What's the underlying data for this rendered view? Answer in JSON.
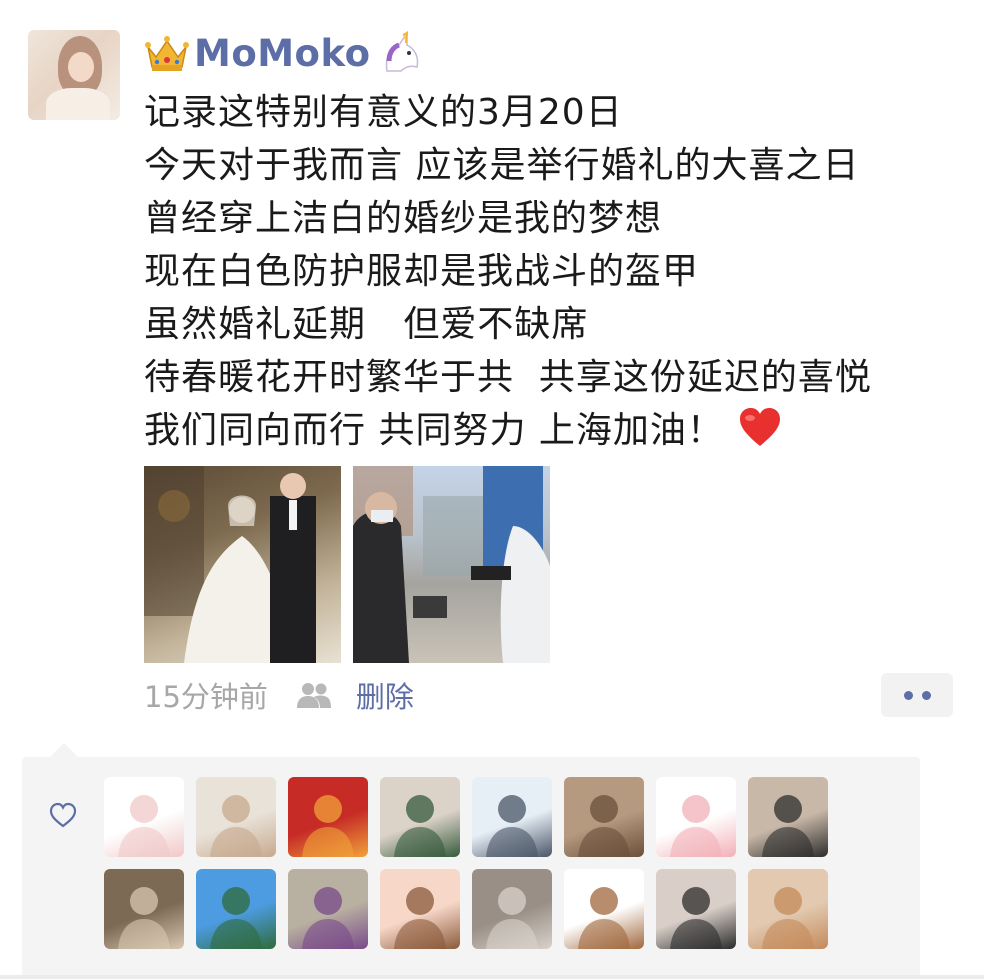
{
  "post": {
    "username": "MoMoko",
    "lines": [
      "记录这特别有意义的3月20日",
      "今天对于我而言 应该是举行婚礼的大喜之日",
      "曾经穿上洁白的婚纱是我的梦想",
      "现在白色防护服却是我战斗的盔甲",
      "虽然婚礼延期   但爱不缺席",
      "待春暖花开时繁华于共  共享这份延迟的喜悦",
      "我们同向而行 共同努力 上海加油！"
    ],
    "timestamp": "15分钟前",
    "delete_label": "删除"
  },
  "icons": {
    "name_prefix": "crown-emoji",
    "name_suffix": "unicorn-emoji",
    "text_end": "red-heart-emoji",
    "visibility": "group-icon",
    "more": "more-dots-icon",
    "likes": "heart-outline-icon"
  },
  "colors": {
    "username": "#5d6ea6",
    "link": "#5d6ea6",
    "timestamp": "#a7a7a7",
    "text": "#1a1a1a",
    "likes_bg": "#f4f4f4"
  },
  "likers": [
    {
      "name": "liker-1",
      "bg": "#ffffff",
      "fg": "#f0c8c8"
    },
    {
      "name": "liker-2",
      "bg": "#e9e2d8",
      "fg": "#c7a98e"
    },
    {
      "name": "liker-3",
      "bg": "#c62b26",
      "fg": "#f0a23a"
    },
    {
      "name": "liker-4",
      "bg": "#dcd3c8",
      "fg": "#355a3c"
    },
    {
      "name": "liker-5",
      "bg": "#e6eef6",
      "fg": "#4a5566"
    },
    {
      "name": "liker-6",
      "bg": "#b59a80",
      "fg": "#6b4f3a"
    },
    {
      "name": "liker-7",
      "bg": "#ffffff",
      "fg": "#f2b0b8"
    },
    {
      "name": "liker-8",
      "bg": "#c8b8a8",
      "fg": "#2d2d2d"
    },
    {
      "name": "liker-9",
      "bg": "#7d6a55",
      "fg": "#d8c8b0"
    },
    {
      "name": "liker-10",
      "bg": "#4d9be0",
      "fg": "#2e6b3a"
    },
    {
      "name": "liker-11",
      "bg": "#b8b0a0",
      "fg": "#7a4a8a"
    },
    {
      "name": "liker-12",
      "bg": "#f7d7c8",
      "fg": "#8a5a3a"
    },
    {
      "name": "liker-13",
      "bg": "#9a8f86",
      "fg": "#d8d2ca"
    },
    {
      "name": "liker-14",
      "bg": "#ffffff",
      "fg": "#a0673c"
    },
    {
      "name": "liker-15",
      "bg": "#d9cfc8",
      "fg": "#2b2b2b"
    },
    {
      "name": "liker-16",
      "bg": "#e2c9b0",
      "fg": "#c48a5a"
    }
  ]
}
